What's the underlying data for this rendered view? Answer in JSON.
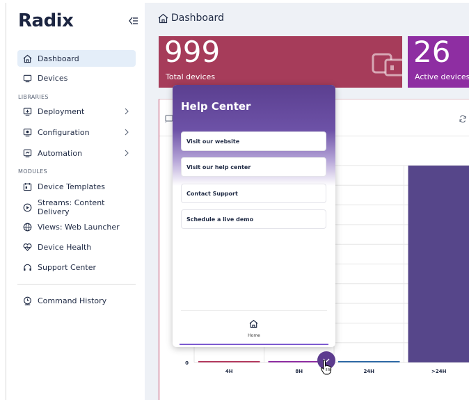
{
  "app": {
    "logo": "Radix"
  },
  "sidebar": {
    "items": [
      {
        "label": "Dashboard"
      },
      {
        "label": "Devices"
      }
    ],
    "libraries_label": "LIBRARIES",
    "libraries": [
      {
        "label": "Deployment"
      },
      {
        "label": "Configuration"
      },
      {
        "label": "Automation"
      }
    ],
    "modules_label": "MODULES",
    "modules": [
      {
        "label": "Device Templates"
      },
      {
        "label": "Streams: Content Delivery"
      },
      {
        "label": "Views: Web Launcher"
      },
      {
        "label": "Device Health"
      },
      {
        "label": "Support Center"
      }
    ],
    "bottom": [
      {
        "label": "Command History"
      }
    ]
  },
  "header": {
    "title": "Dashboard"
  },
  "cards": [
    {
      "value": "999",
      "label": "Total devices",
      "color": "#a63c5a"
    },
    {
      "value": "26",
      "label": "Active devices",
      "color": "#8e2ea2"
    }
  ],
  "help_center": {
    "title": "Help Center",
    "links": [
      {
        "label": "Visit our website"
      },
      {
        "label": "Visit our help center"
      },
      {
        "label": "Contact Support"
      },
      {
        "label": "Schedule a live demo"
      }
    ],
    "footer_label": "Home"
  },
  "chart_data": {
    "type": "bar",
    "categories": [
      "4H",
      "8H",
      "24H",
      ">24H"
    ],
    "values": [
      0,
      0,
      0,
      999
    ],
    "ytick_labels": [
      "0"
    ],
    "colors": [
      "#b33a5e",
      "#8e2ea2",
      "#2f6aa6",
      "#56468a"
    ],
    "ylim": [
      0,
      999
    ]
  }
}
